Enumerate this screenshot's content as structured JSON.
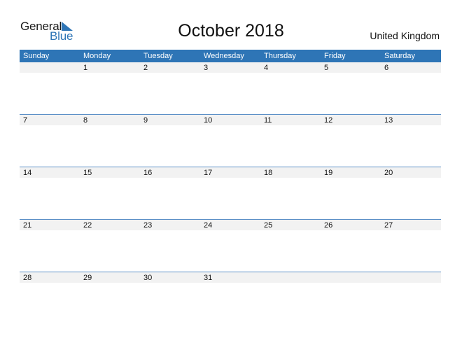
{
  "logo": {
    "line1": "General",
    "line2": "Blue"
  },
  "title": "October 2018",
  "country": "United Kingdom",
  "colors": {
    "accent": "#2e75b6",
    "strip": "#f2f2f2"
  },
  "weekdays": [
    "Sunday",
    "Monday",
    "Tuesday",
    "Wednesday",
    "Thursday",
    "Friday",
    "Saturday"
  ],
  "weeks": [
    [
      "",
      "1",
      "2",
      "3",
      "4",
      "5",
      "6"
    ],
    [
      "7",
      "8",
      "9",
      "10",
      "11",
      "12",
      "13"
    ],
    [
      "14",
      "15",
      "16",
      "17",
      "18",
      "19",
      "20"
    ],
    [
      "21",
      "22",
      "23",
      "24",
      "25",
      "26",
      "27"
    ],
    [
      "28",
      "29",
      "30",
      "31",
      "",
      "",
      ""
    ]
  ]
}
